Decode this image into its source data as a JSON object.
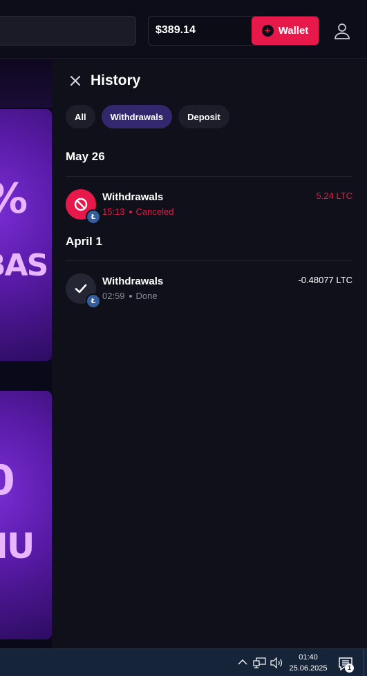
{
  "header": {
    "search_placeholder": "",
    "balance": "$389.14",
    "wallet_label": "Wallet"
  },
  "promo": {
    "text_1a": "%",
    "text_1b": "BAS",
    "text_2a": "0",
    "text_2b": "NU"
  },
  "history": {
    "title": "History",
    "tabs": [
      {
        "label": "All",
        "active": false
      },
      {
        "label": "Withdrawals",
        "active": true
      },
      {
        "label": "Deposit",
        "active": false
      }
    ],
    "groups": [
      {
        "date": "May 26",
        "transactions": [
          {
            "title": "Withdrawals",
            "time": "15:13",
            "status": "Canceled",
            "amount": "5.24 LTC",
            "state": "canceled",
            "coin": "Ł"
          }
        ]
      },
      {
        "date": "April 1",
        "transactions": [
          {
            "title": "Withdrawals",
            "time": "02:59",
            "status": "Done",
            "amount": "-0.48077 LTC",
            "state": "done",
            "coin": "Ł"
          }
        ]
      }
    ]
  },
  "taskbar": {
    "time": "01:40",
    "date": "25.06.2025",
    "notification_count": "1"
  },
  "colors": {
    "accent": "#e6194a",
    "active_tab": "#33286e",
    "panel_bg": "#0f1019"
  }
}
